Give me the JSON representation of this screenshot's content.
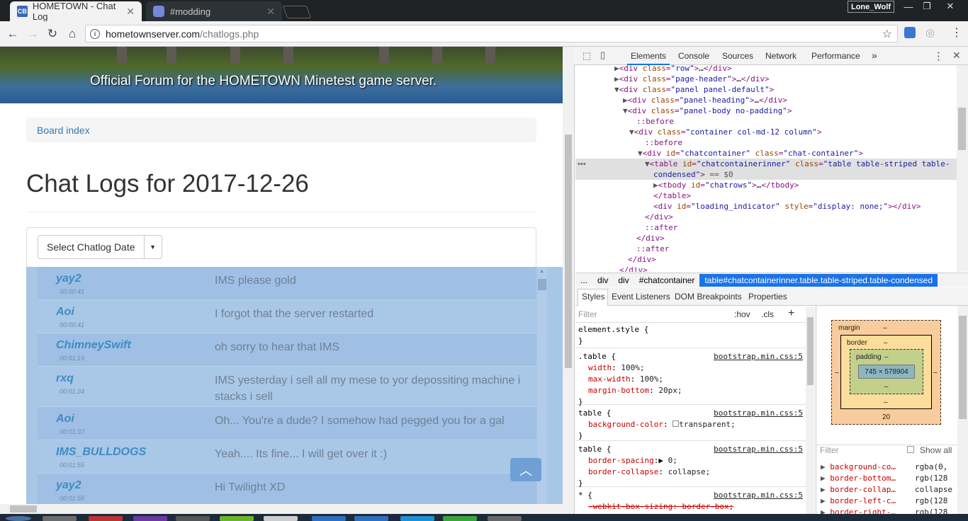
{
  "browser": {
    "tabs": [
      {
        "favicon": "CB",
        "title": "HOMETOWN - Chat Log"
      },
      {
        "favicon": "discord-icon",
        "title": "#modding"
      }
    ],
    "profile_name": "Lone_Wolf",
    "window_controls": [
      "minimize",
      "restore",
      "close"
    ],
    "url_host": "hometownserver.com",
    "url_path": "/chatlogs.php"
  },
  "page": {
    "banner_text": "Official Forum for the HOMETOWN Minetest game server.",
    "breadcrumb": "Board index",
    "title": "Chat Logs for 2017-12-26",
    "date_button_label": "Select Chatlog Date",
    "chat_rows": [
      {
        "user": "yay2",
        "time": "00:00:41",
        "message": "IMS please gold"
      },
      {
        "user": "Aoi",
        "time": "00:00:41",
        "message": "I forgot that the server restarted"
      },
      {
        "user": "ChimneySwift",
        "time": "00:01:19",
        "message": "oh sorry to hear that IMS"
      },
      {
        "user": "rxq",
        "time": "00:01:34",
        "message": "IMS yesterday i sell all my mese to yor depossiting machine i stacks i sell"
      },
      {
        "user": "Aoi",
        "time": "00:01:37",
        "message": "Oh... You're a dude? I somehow had pegged you for a gal"
      },
      {
        "user": "IMS_BULLDOGS",
        "time": "00:01:55",
        "message": "Yeah.... Its fine... I will get over it :)"
      },
      {
        "user": "yay2",
        "time": "00:01:55",
        "message": "Hi Twilight XD"
      }
    ]
  },
  "devtools": {
    "tabs": [
      "Elements",
      "Console",
      "Sources",
      "Network",
      "Performance"
    ],
    "more_tabs": "»",
    "breadcrumbs": [
      "...",
      "div",
      "div",
      "#chatcontainer",
      "table#chatcontainerinner.table.table-striped.table-condensed"
    ],
    "subtabs": [
      "Styles",
      "Event Listeners",
      "DOM Breakpoints",
      "Properties"
    ],
    "filter_placeholder": "Filter",
    "hov": ":hov",
    "cls": ".cls",
    "box_model": {
      "margin_label": "margin",
      "border_label": "border",
      "padding_label": "padding",
      "dash": "–",
      "content_size": "745 × 578904",
      "margin_bottom": "20"
    },
    "computed_filter": "Filter",
    "show_all": "Show all",
    "computed": [
      {
        "name": "background-co…",
        "value": "rgba(0,"
      },
      {
        "name": "border-bottom…",
        "value": "rgb(128"
      },
      {
        "name": "border-collap…",
        "value": "collapse"
      },
      {
        "name": "border-left-c…",
        "value": "rgb(128"
      },
      {
        "name": "border-right-…",
        "value": "rgb(128"
      }
    ],
    "source_bootstrap": "bootstrap.min.css:5",
    "styles": {
      "element_style": "element.style {",
      "close": "}",
      "sel_table_class": ".table {",
      "sel_table": "table {",
      "sel_star": "* {",
      "width_prop": "width",
      "width_val": "100%;",
      "maxw_prop": "max-width",
      "maxw_val": "100%;",
      "mb_prop": "margin-bottom",
      "mb_val": "20px;",
      "bg_prop": "background-color",
      "bg_val": "transparent;",
      "bs_prop": "border-spacing",
      "bs_val": "0;",
      "bc_prop": "border-collapse",
      "bc_val": "collapse;",
      "wk_line": "-webkit-box-sizing: border-box;"
    }
  }
}
